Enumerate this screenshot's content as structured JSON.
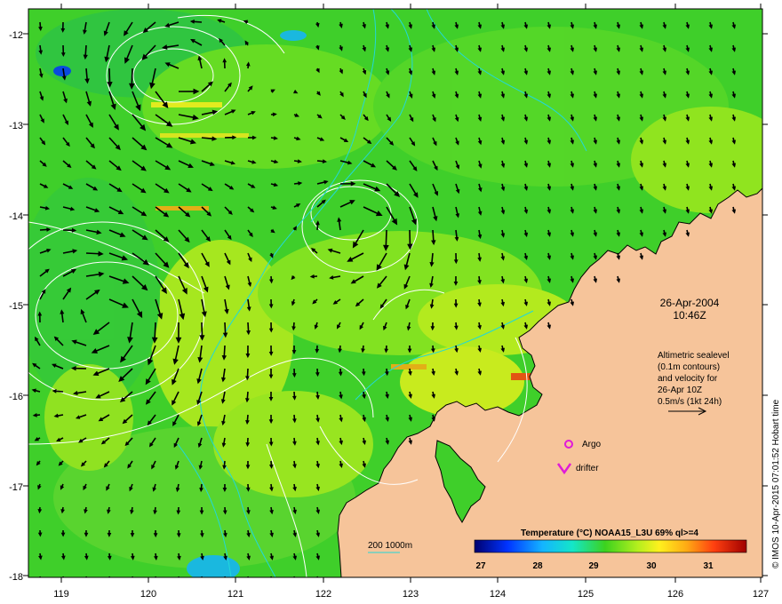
{
  "map": {
    "lon_ticks": [
      "119",
      "120",
      "121",
      "122",
      "123",
      "124",
      "125",
      "126",
      "127"
    ],
    "lat_ticks": [
      "-12",
      "-13",
      "-14",
      "-15",
      "-16",
      "-17",
      "-18"
    ],
    "date": "26-Apr-2004",
    "time": "10:46Z",
    "altimetry_lines": [
      "Altimetric sealevel",
      "(0.1m contours)",
      "and velocity for",
      "26-Apr 10Z",
      "0.5m/s (1kt 24h)"
    ],
    "legend_argo": "Argo",
    "legend_drifter": "drifter",
    "depth_label": "200  1000m",
    "colorbar_title": "Temperature (°C) NOAA15_L3U 69% ql>=4",
    "colorbar_ticks": [
      "27",
      "28",
      "29",
      "30",
      "31"
    ],
    "credit": "© IMOS 10-Apr-2015 07:01:52 Hobart time",
    "colors": {
      "ocean": "#3fcf2a",
      "land": "#f6c49a",
      "contour": "#ffffff",
      "isobath": "#22d8d8",
      "argo": "#e01ad8"
    }
  }
}
